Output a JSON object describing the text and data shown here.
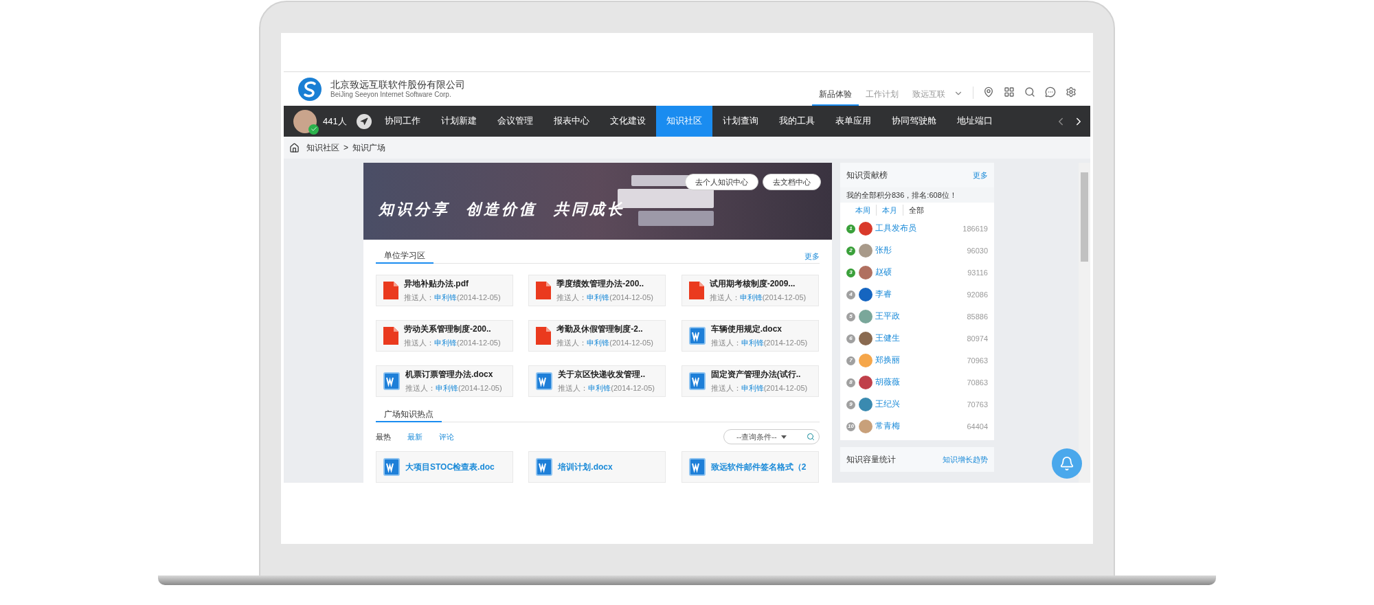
{
  "company": {
    "name": "北京致远互联软件股份有限公司",
    "subtitle": "BeiJing Seeyon Internet Software Corp."
  },
  "header_tabs": [
    {
      "label": "新品体验",
      "selected": true
    },
    {
      "label": "工作计划",
      "selected": false
    },
    {
      "label": "致远互联",
      "selected": false
    }
  ],
  "nav": {
    "online_count": "441人",
    "items": [
      {
        "label": "协同工作",
        "selected": false
      },
      {
        "label": "计划新建",
        "selected": false
      },
      {
        "label": "会议管理",
        "selected": false
      },
      {
        "label": "报表中心",
        "selected": false
      },
      {
        "label": "文化建设",
        "selected": false
      },
      {
        "label": "知识社区",
        "selected": true
      },
      {
        "label": "计划查询",
        "selected": false
      },
      {
        "label": "我的工具",
        "selected": false
      },
      {
        "label": "表单应用",
        "selected": false
      },
      {
        "label": "协同驾驶舱",
        "selected": false
      },
      {
        "label": "地址端口",
        "selected": false
      }
    ]
  },
  "breadcrumb": [
    "知识社区",
    ">",
    "知识广场"
  ],
  "banner": {
    "slogan": "知识分享  创造价值  共同成长",
    "buttons": [
      "去个人知识中心",
      "去文档中心"
    ]
  },
  "unit_study": {
    "title": "单位学习区",
    "more": "更多",
    "docs": [
      {
        "kind": "pdf",
        "title": "异地补贴办法.pdf",
        "pusher_label": "推送人：",
        "pusher": "申利锋",
        "date": "(2014-12-05)"
      },
      {
        "kind": "pdf",
        "title": "季度绩效管理办法-200..",
        "pusher_label": "推送人：",
        "pusher": "申利锋",
        "date": "(2014-12-05)"
      },
      {
        "kind": "pdf",
        "title": "试用期考核制度-2009...",
        "pusher_label": "推送人：",
        "pusher": "申利锋",
        "date": "(2014-12-05)"
      },
      {
        "kind": "pdf",
        "title": "劳动关系管理制度-200..",
        "pusher_label": "推送人：",
        "pusher": "申利锋",
        "date": "(2014-12-05)"
      },
      {
        "kind": "pdf",
        "title": "考勤及休假管理制度-2..",
        "pusher_label": "推送人：",
        "pusher": "申利锋",
        "date": "(2014-12-05)"
      },
      {
        "kind": "word",
        "title": "车辆使用规定.docx",
        "pusher_label": "推送人：",
        "pusher": "申利锋",
        "date": "(2014-12-05)"
      },
      {
        "kind": "word",
        "title": "机票订票管理办法.docx",
        "pusher_label": "推送人：",
        "pusher": "申利锋",
        "date": "(2014-12-05)"
      },
      {
        "kind": "word",
        "title": "关于京区快递收发管理..",
        "pusher_label": "推送人：",
        "pusher": "申利锋",
        "date": "(2014-12-05)"
      },
      {
        "kind": "word",
        "title": "固定资产管理办法(试行..",
        "pusher_label": "推送人：",
        "pusher": "申利锋",
        "date": "(2014-12-05)"
      }
    ]
  },
  "hot": {
    "title": "广场知识热点",
    "filters": [
      {
        "label": "最热",
        "selected": true
      },
      {
        "label": "最新",
        "selected": false
      },
      {
        "label": "评论",
        "selected": false
      }
    ],
    "query_select": "--查询条件--",
    "docs": [
      {
        "kind": "word",
        "title": "大项目STOC检查表.doc"
      },
      {
        "kind": "word",
        "title": "培训计划.docx"
      },
      {
        "kind": "word",
        "title": "致远软件邮件签名格式（2"
      }
    ]
  },
  "ranking": {
    "title": "知识贡献榜",
    "more": "更多",
    "my_score": "我的全部积分836，排名:608位！",
    "periods": [
      {
        "label": "本周",
        "selected": false
      },
      {
        "label": "本月",
        "selected": false
      },
      {
        "label": "全部",
        "selected": true
      }
    ],
    "rows": [
      {
        "rank": "1",
        "top": true,
        "name": "工具发布员",
        "score": "186619",
        "color": "#d93a2b"
      },
      {
        "rank": "2",
        "top": true,
        "name": "张彤",
        "score": "96030",
        "color": "#a89a8a"
      },
      {
        "rank": "3",
        "top": true,
        "name": "赵硕",
        "score": "93116",
        "color": "#b07060"
      },
      {
        "rank": "4",
        "top": false,
        "name": "李睿",
        "score": "92086",
        "color": "#1565c0"
      },
      {
        "rank": "5",
        "top": false,
        "name": "王平政",
        "score": "85886",
        "color": "#7aa79a"
      },
      {
        "rank": "6",
        "top": false,
        "name": "王健生",
        "score": "80974",
        "color": "#8a6a50"
      },
      {
        "rank": "7",
        "top": false,
        "name": "郑换丽",
        "score": "70963",
        "color": "#f5a64a"
      },
      {
        "rank": "8",
        "top": false,
        "name": "胡薇薇",
        "score": "70863",
        "color": "#c0404a"
      },
      {
        "rank": "9",
        "top": false,
        "name": "王纪兴",
        "score": "70763",
        "color": "#3a8ab0"
      },
      {
        "rank": "10",
        "top": false,
        "name": "常青梅",
        "score": "64404",
        "color": "#c8a07a"
      }
    ]
  },
  "capacity": {
    "title": "知识容量统计",
    "link": "知识增长趋势"
  }
}
